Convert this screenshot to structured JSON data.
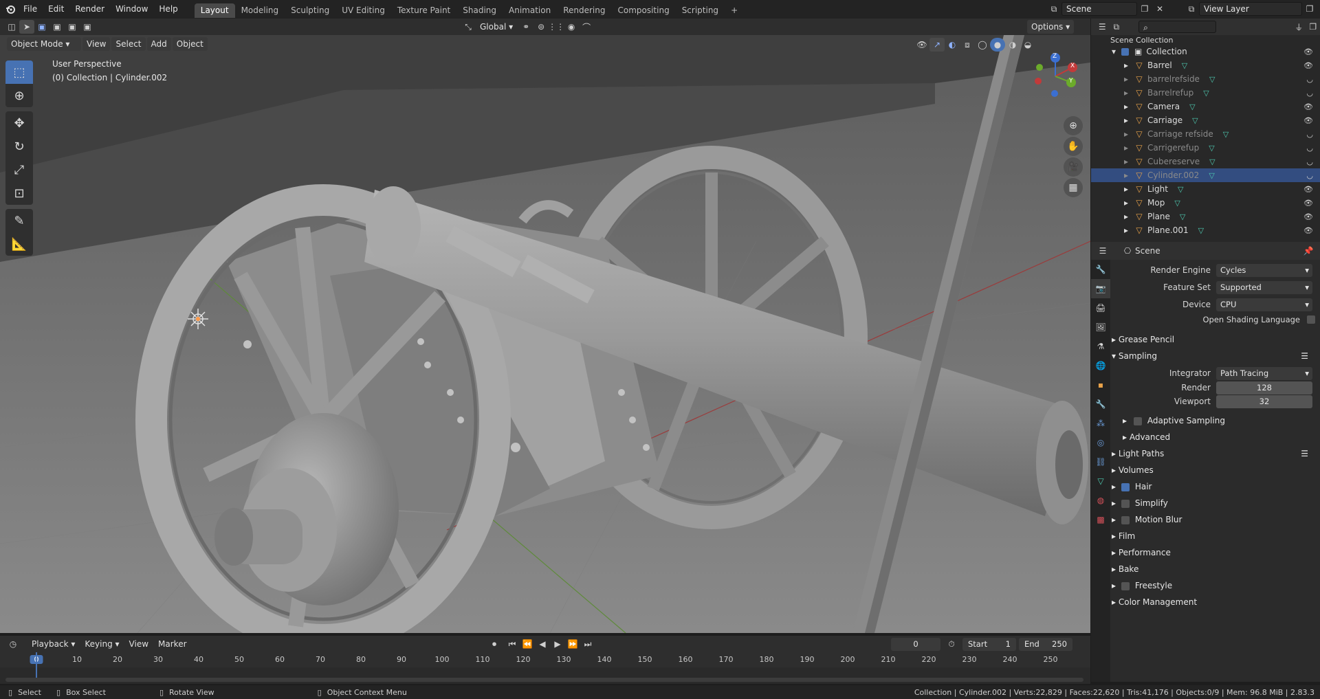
{
  "topbar": {
    "menus": [
      "File",
      "Edit",
      "Render",
      "Window",
      "Help"
    ],
    "workspaces": [
      "Layout",
      "Modeling",
      "Sculpting",
      "UV Editing",
      "Texture Paint",
      "Shading",
      "Animation",
      "Rendering",
      "Compositing",
      "Scripting"
    ],
    "active_workspace": "Layout",
    "scene": "Scene",
    "view_layer": "View Layer"
  },
  "viewport_header": {
    "mode": "Object Mode",
    "menus": [
      "View",
      "Select",
      "Add",
      "Object"
    ],
    "transform_orientation": "Global",
    "options": "Options"
  },
  "viewport": {
    "perspective": "User Perspective",
    "collection_info": "(0) Collection | Cylinder.002",
    "gizmo_axes": [
      "Z",
      "X",
      "Y"
    ]
  },
  "outliner": {
    "scene_collection": "Scene Collection",
    "collection": "Collection",
    "items": [
      {
        "name": "Barrel",
        "dim": false,
        "selected": false
      },
      {
        "name": "barrelrefside",
        "dim": true,
        "selected": false
      },
      {
        "name": "Barrelrefup",
        "dim": true,
        "selected": false
      },
      {
        "name": "Camera",
        "dim": false,
        "selected": false
      },
      {
        "name": "Carriage",
        "dim": false,
        "selected": false
      },
      {
        "name": "Carriage refside",
        "dim": true,
        "selected": false
      },
      {
        "name": "Carrigerefup",
        "dim": true,
        "selected": false
      },
      {
        "name": "Cubereserve",
        "dim": true,
        "selected": false
      },
      {
        "name": "Cylinder.002",
        "dim": true,
        "selected": true
      },
      {
        "name": "Light",
        "dim": false,
        "selected": false
      },
      {
        "name": "Mop",
        "dim": false,
        "selected": false
      },
      {
        "name": "Plane",
        "dim": false,
        "selected": false
      },
      {
        "name": "Plane.001",
        "dim": false,
        "selected": false
      }
    ]
  },
  "properties": {
    "context": "Scene",
    "render_engine_label": "Render Engine",
    "render_engine": "Cycles",
    "feature_set_label": "Feature Set",
    "feature_set": "Supported",
    "device_label": "Device",
    "device": "CPU",
    "osl_label": "Open Shading Language",
    "grease_pencil": "Grease Pencil",
    "sampling": "Sampling",
    "integrator_label": "Integrator",
    "integrator": "Path Tracing",
    "render_label": "Render",
    "render_samples": "128",
    "viewport_label": "Viewport",
    "viewport_samples": "32",
    "adaptive_sampling": "Adaptive Sampling",
    "advanced": "Advanced",
    "light_paths": "Light Paths",
    "volumes": "Volumes",
    "hair": "Hair",
    "simplify": "Simplify",
    "motion_blur": "Motion Blur",
    "film": "Film",
    "performance": "Performance",
    "bake": "Bake",
    "freestyle": "Freestyle",
    "color_management": "Color Management"
  },
  "timeline": {
    "menus": [
      "Playback",
      "Keying",
      "View",
      "Marker"
    ],
    "current_frame": "0",
    "start_label": "Start",
    "start": "1",
    "end_label": "End",
    "end": "250",
    "ticks": [
      "0",
      "10",
      "20",
      "30",
      "40",
      "50",
      "60",
      "70",
      "80",
      "90",
      "100",
      "110",
      "120",
      "130",
      "140",
      "150",
      "160",
      "170",
      "180",
      "190",
      "200",
      "210",
      "220",
      "230",
      "240",
      "250"
    ]
  },
  "statusbar": {
    "select": "Select",
    "box_select": "Box Select",
    "rotate_view": "Rotate View",
    "context_menu": "Object Context Menu",
    "stats": "Collection | Cylinder.002 | Verts:22,829 | Faces:22,620 | Tris:41,176 | Objects:0/9 | Mem: 96.8 MiB | 2.83.3"
  },
  "colors": {
    "accent": "#4772b3",
    "selection": "#334d80",
    "object_orange": "#e8a24a",
    "mesh_green": "#4ec9b0"
  }
}
